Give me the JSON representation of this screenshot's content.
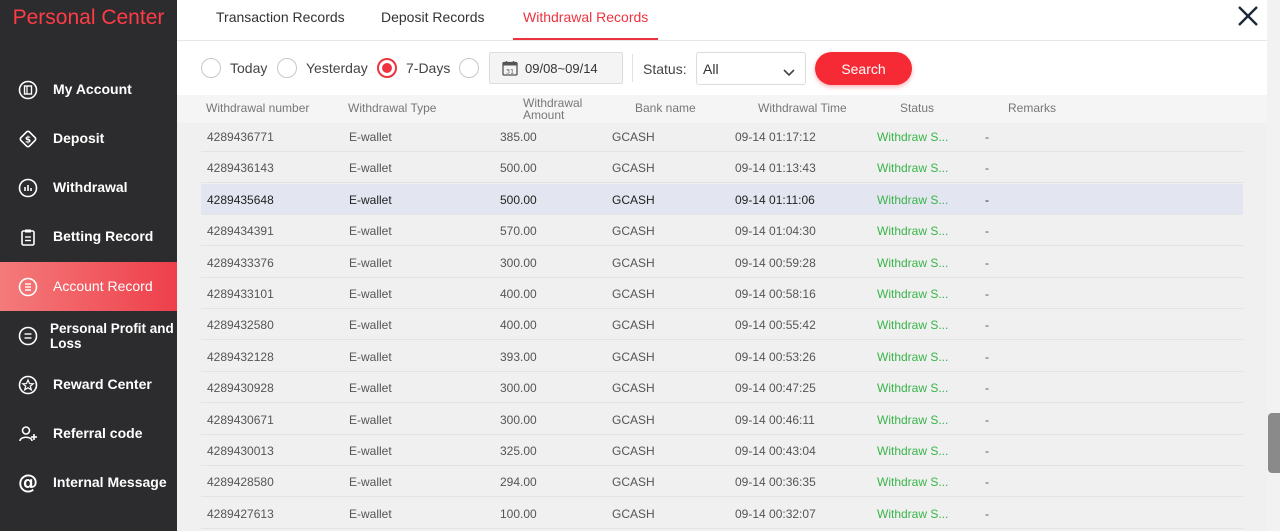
{
  "sidebar": {
    "title": "Personal Center",
    "items": [
      {
        "label": "My Account",
        "icon": "account-icon"
      },
      {
        "label": "Deposit",
        "icon": "deposit-icon"
      },
      {
        "label": "Withdrawal",
        "icon": "withdrawal-icon"
      },
      {
        "label": "Betting Record",
        "icon": "clipboard-icon"
      },
      {
        "label": "Account Record",
        "icon": "list-icon",
        "active": true
      },
      {
        "label": "Personal Profit and Loss",
        "icon": "profit-icon"
      },
      {
        "label": "Reward Center",
        "icon": "star-icon"
      },
      {
        "label": "Referral code",
        "icon": "referral-icon"
      },
      {
        "label": "Internal Message",
        "icon": "at-icon"
      }
    ]
  },
  "tabs": [
    {
      "label": "Transaction Records"
    },
    {
      "label": "Deposit Records"
    },
    {
      "label": "Withdrawal Records",
      "active": true
    }
  ],
  "filters": {
    "ranges": [
      {
        "label": "Today",
        "checked": false
      },
      {
        "label": "Yesterday",
        "checked": false
      },
      {
        "label": "7-Days",
        "checked": true
      }
    ],
    "custom_range_checked": false,
    "calendar_day": "31",
    "date_range": "09/08~09/14",
    "status_label": "Status:",
    "status_value": "All",
    "search_label": "Search"
  },
  "colors": {
    "accent": "#ee3340",
    "sidebar_bg": "#2c2c2e",
    "status_success": "#39b54a"
  },
  "table": {
    "columns": [
      "Withdrawal number",
      "Withdrawal Type",
      "Withdrawal Amount",
      "Bank name",
      "Withdrawal Time",
      "Status",
      "Remarks"
    ],
    "rows": [
      {
        "number": "4289436771",
        "type": "E-wallet",
        "amount": "385.00",
        "bank": "GCASH",
        "time": "09-14 01:17:12",
        "status": "Withdraw S...",
        "remarks": "-"
      },
      {
        "number": "4289436143",
        "type": "E-wallet",
        "amount": "500.00",
        "bank": "GCASH",
        "time": "09-14 01:13:43",
        "status": "Withdraw S...",
        "remarks": "-"
      },
      {
        "number": "4289435648",
        "type": "E-wallet",
        "amount": "500.00",
        "bank": "GCASH",
        "time": "09-14 01:11:06",
        "status": "Withdraw S...",
        "remarks": "-",
        "highlighted": true
      },
      {
        "number": "4289434391",
        "type": "E-wallet",
        "amount": "570.00",
        "bank": "GCASH",
        "time": "09-14 01:04:30",
        "status": "Withdraw S...",
        "remarks": "-"
      },
      {
        "number": "4289433376",
        "type": "E-wallet",
        "amount": "300.00",
        "bank": "GCASH",
        "time": "09-14 00:59:28",
        "status": "Withdraw S...",
        "remarks": "-"
      },
      {
        "number": "4289433101",
        "type": "E-wallet",
        "amount": "400.00",
        "bank": "GCASH",
        "time": "09-14 00:58:16",
        "status": "Withdraw S...",
        "remarks": "-"
      },
      {
        "number": "4289432580",
        "type": "E-wallet",
        "amount": "400.00",
        "bank": "GCASH",
        "time": "09-14 00:55:42",
        "status": "Withdraw S...",
        "remarks": "-"
      },
      {
        "number": "4289432128",
        "type": "E-wallet",
        "amount": "393.00",
        "bank": "GCASH",
        "time": "09-14 00:53:26",
        "status": "Withdraw S...",
        "remarks": "-"
      },
      {
        "number": "4289430928",
        "type": "E-wallet",
        "amount": "300.00",
        "bank": "GCASH",
        "time": "09-14 00:47:25",
        "status": "Withdraw S...",
        "remarks": "-"
      },
      {
        "number": "4289430671",
        "type": "E-wallet",
        "amount": "300.00",
        "bank": "GCASH",
        "time": "09-14 00:46:11",
        "status": "Withdraw S...",
        "remarks": "-"
      },
      {
        "number": "4289430013",
        "type": "E-wallet",
        "amount": "325.00",
        "bank": "GCASH",
        "time": "09-14 00:43:04",
        "status": "Withdraw S...",
        "remarks": "-"
      },
      {
        "number": "4289428580",
        "type": "E-wallet",
        "amount": "294.00",
        "bank": "GCASH",
        "time": "09-14 00:36:35",
        "status": "Withdraw S...",
        "remarks": "-"
      },
      {
        "number": "4289427613",
        "type": "E-wallet",
        "amount": "100.00",
        "bank": "GCASH",
        "time": "09-14 00:32:07",
        "status": "Withdraw S...",
        "remarks": "-"
      }
    ]
  }
}
